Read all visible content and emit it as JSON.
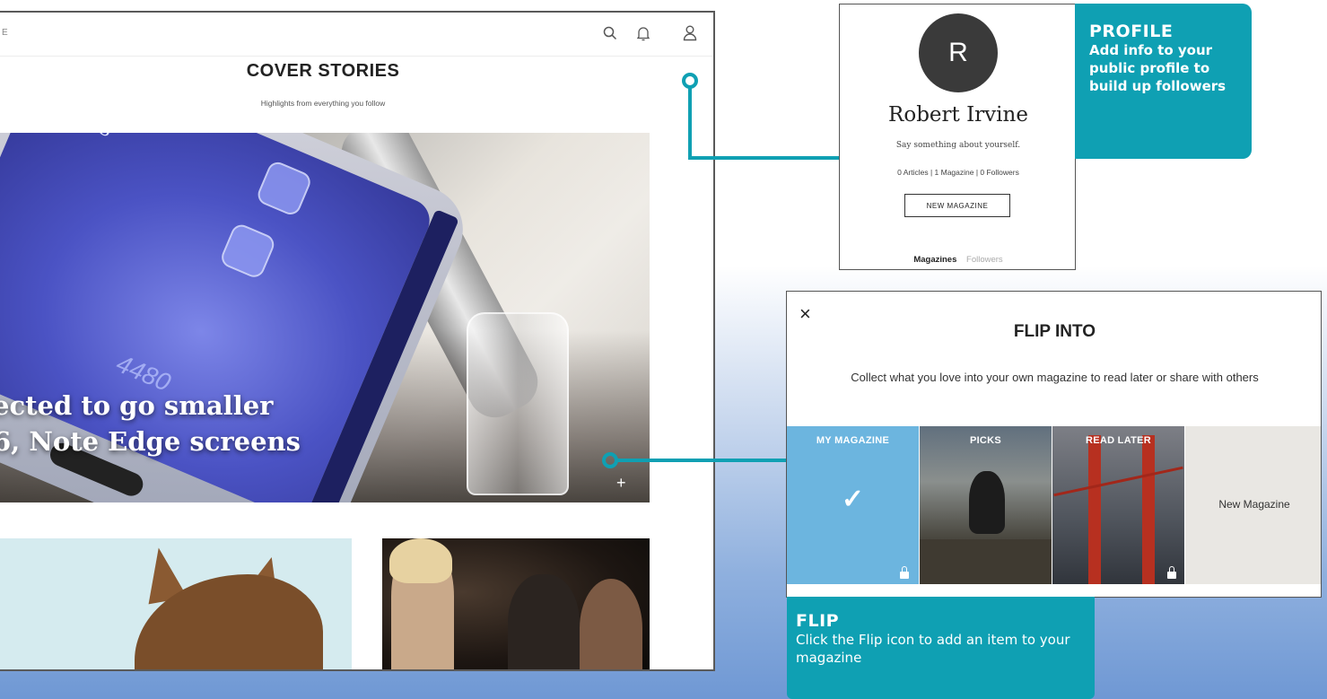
{
  "app": {
    "brand": "E",
    "cover_title": "COVER STORIES",
    "cover_subtitle": "Highlights from everything you follow",
    "icons": [
      "search-icon",
      "bell-icon",
      "profile-icon"
    ],
    "hero_headline_line1": "ected to go smaller",
    "hero_headline_line2": "6, Note Edge screens",
    "hero_phone_text": "Gifts",
    "hero_phone_number": "4480",
    "flip_button": "+"
  },
  "profile": {
    "avatar_initial": "R",
    "name": "Robert Irvine",
    "bio": "Say something about yourself.",
    "stats": "0 Articles  |  1 Magazine  |  0 Followers",
    "new_magazine_label": "NEW MAGAZINE",
    "tabs": [
      {
        "label": "Magazines",
        "active": true
      },
      {
        "label": "Followers",
        "active": false
      }
    ]
  },
  "profile_callout": {
    "title": "PROFILE",
    "body": "Add info to your public profile to build up followers"
  },
  "flip_into": {
    "close_label": "×",
    "title": "FLIP INTO",
    "description": "Collect what you love into your own magazine to read later or share with others",
    "tiles": [
      {
        "label": "MY MAGAZINE",
        "selected": true,
        "private": true
      },
      {
        "label": "PICKS",
        "selected": false,
        "private": false
      },
      {
        "label": "READ LATER",
        "selected": false,
        "private": true
      },
      {
        "label": "New Magazine",
        "selected": false,
        "private": false
      }
    ],
    "check_mark": "✓"
  },
  "flip_callout": {
    "title": "FLIP",
    "body": "Click the Flip icon to add an item to your magazine"
  },
  "colors": {
    "accent": "#0fa0b3",
    "my_magazine_tile": "#6cb5df",
    "new_magazine_tile": "#e9e7e3"
  }
}
